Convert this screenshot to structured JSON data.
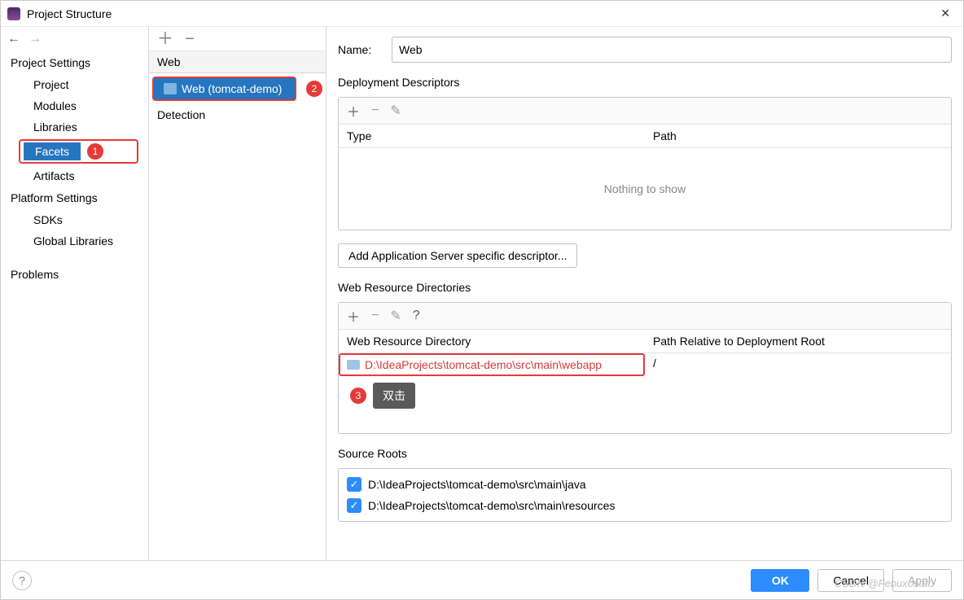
{
  "window": {
    "title": "Project Structure"
  },
  "sidebar": {
    "section_project": "Project Settings",
    "items_project": [
      "Project",
      "Modules",
      "Libraries",
      "Facets",
      "Artifacts"
    ],
    "selected": "Facets",
    "section_platform": "Platform Settings",
    "items_platform": [
      "SDKs",
      "Global Libraries"
    ],
    "section_problems": "Problems"
  },
  "annotations": {
    "badge1": "1",
    "badge2": "2",
    "badge3": "3",
    "tooltip3": "双击"
  },
  "middle": {
    "items": [
      {
        "label": "Web",
        "type": "group"
      },
      {
        "label": "Web (tomcat-demo)",
        "type": "child",
        "selected": true
      },
      {
        "label": "Detection",
        "type": "group"
      }
    ]
  },
  "main": {
    "name_label": "Name:",
    "name_value": "Web",
    "sections": {
      "deployment": {
        "title": "Deployment Descriptors",
        "columns": [
          "Type",
          "Path"
        ],
        "empty": "Nothing to show",
        "server_button": "Add Application Server specific descriptor..."
      },
      "web_resources": {
        "title": "Web Resource Directories",
        "columns": [
          "Web Resource Directory",
          "Path Relative to Deployment Root"
        ],
        "rows": [
          {
            "dir": "D:\\IdeaProjects\\tomcat-demo\\src\\main\\webapp",
            "rel": "/"
          }
        ]
      },
      "source_roots": {
        "title": "Source Roots",
        "items": [
          {
            "checked": true,
            "path": "D:\\IdeaProjects\\tomcat-demo\\src\\main\\java"
          },
          {
            "checked": true,
            "path": "D:\\IdeaProjects\\tomcat-demo\\src\\main\\resources"
          }
        ]
      }
    }
  },
  "footer": {
    "ok": "OK",
    "cancel": "Cancel",
    "apply": "Apply",
    "watermark": "CSDN @Febuxostat"
  }
}
